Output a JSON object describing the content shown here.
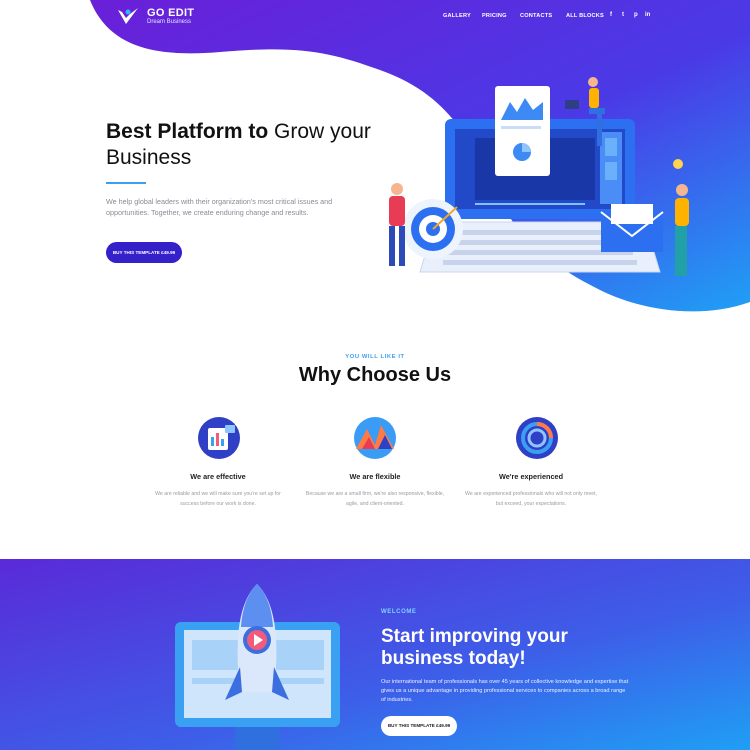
{
  "brand": {
    "title": "GO EDIT",
    "subtitle": "Dream Business"
  },
  "nav": {
    "items": [
      "GALLERY",
      "PRICING",
      "CONTACTS",
      "ALL BLOCKS"
    ]
  },
  "social": [
    "f",
    "t",
    "p",
    "in"
  ],
  "social_icons": [
    "facebook-icon",
    "twitter-icon",
    "pinterest-icon",
    "linkedin-icon"
  ],
  "hero": {
    "title_bold": "Best Platform to",
    "title_rest": "Grow your Business",
    "description": "We help global leaders with their organization's most critical issues and opportunities. Together, we create enduring change and results.",
    "button": "BUY THIS TEMPLATE £49.99"
  },
  "why": {
    "eyebrow": "YOU WILL LIKE IT",
    "title": "Why Choose Us",
    "features": [
      {
        "title": "We are effective",
        "icon": "document-chart-icon",
        "desc": "We are reliable and we will make sure you're set up for success before our work is done."
      },
      {
        "title": "We are flexible",
        "icon": "mountains-icon",
        "desc": "Because we are a small firm, we're also responsive, flexible, agile, and client-oriented."
      },
      {
        "title": "We're experienced",
        "icon": "radial-chart-icon",
        "desc": "We are experienced professionals who will not only meet, but exceed, your expectations."
      }
    ]
  },
  "cta": {
    "eyebrow": "WELCOME",
    "title": "Start improving your business today!",
    "description": "Our international team of professionals has over 45 years of collective knowledge and expertise that gives us a unique advantage in providing professional services to companies across a broad range of industries.",
    "button": "BUY THIS TEMPLATE £49.99"
  },
  "colors": {
    "purple": "#5a1fd6",
    "blue": "#2f7cf0",
    "accent": "#3aa0f2",
    "button_dark": "#3521c9"
  }
}
